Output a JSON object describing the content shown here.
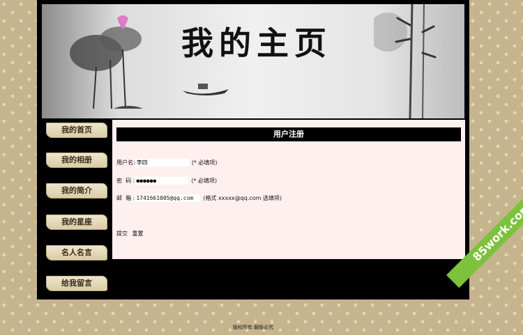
{
  "banner": {
    "title": "我的主页"
  },
  "nav": {
    "items": [
      {
        "label": "我的首页"
      },
      {
        "label": "我的相册"
      },
      {
        "label": "我的简介"
      },
      {
        "label": "我的星座"
      },
      {
        "label": "名人名言"
      },
      {
        "label": "给我留言"
      }
    ]
  },
  "form": {
    "heading": "用户注册",
    "username": {
      "label": "用户名:",
      "value": "李四",
      "note": "(* 必填项)"
    },
    "password": {
      "label": "密  码 :",
      "value": "●●●●●●",
      "note": "(* 必填项)"
    },
    "email": {
      "label": "邮  箱 :",
      "value": "1741661005@qq.com",
      "note": "(格式 xxxxx@qq.com 选填项)"
    },
    "submit_label": "提交",
    "reset_label": "重置"
  },
  "footer": {
    "text": "版权所有 翻版必究"
  },
  "watermark": {
    "text": "85work.com"
  },
  "colors": {
    "frame": "#000000",
    "content_bg": "#fff0f0",
    "watermark": "#7cc23b"
  }
}
